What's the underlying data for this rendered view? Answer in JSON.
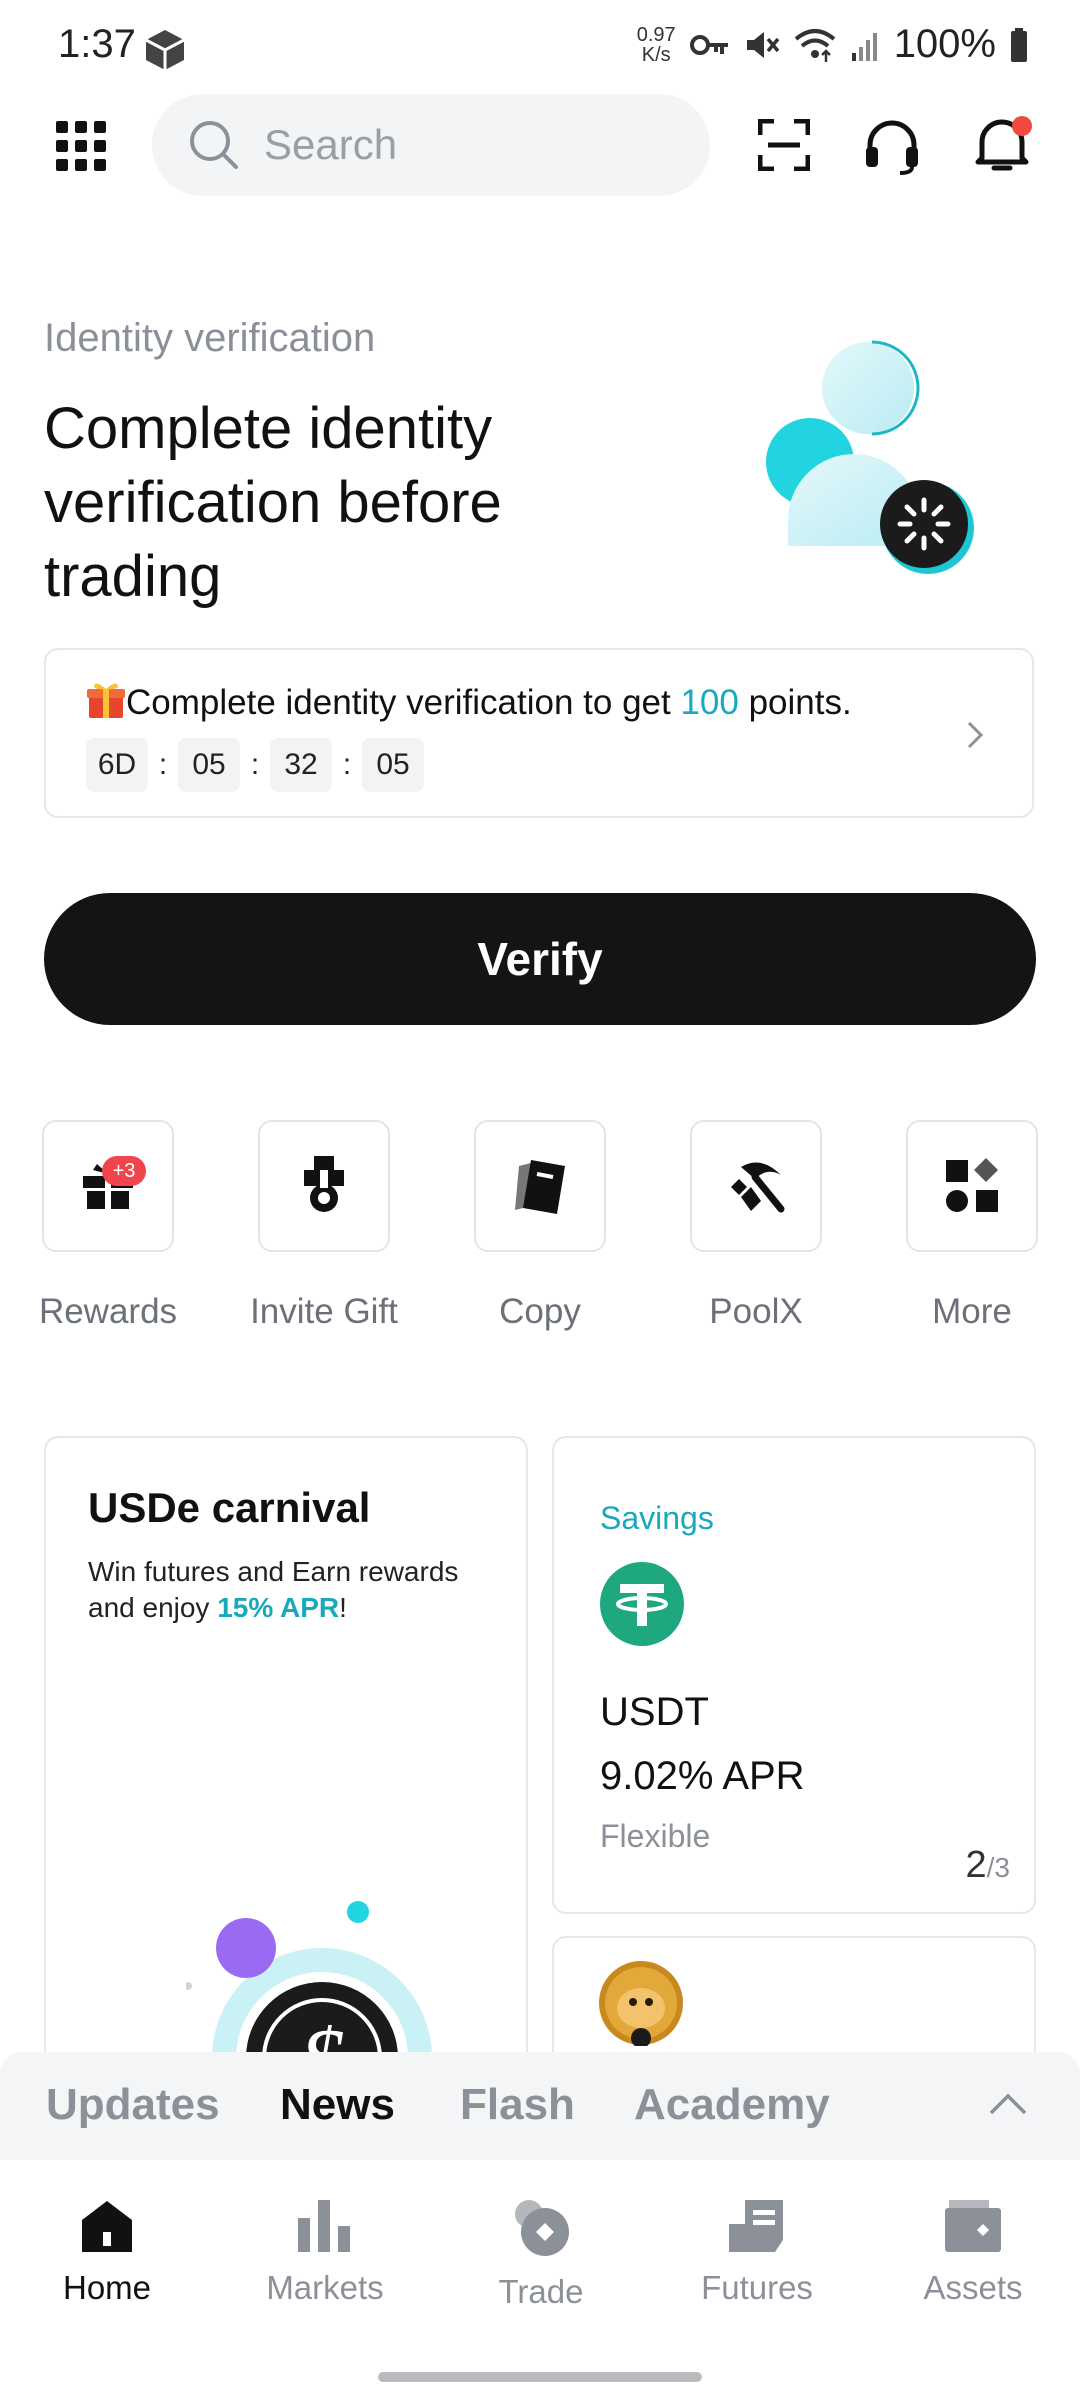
{
  "status_bar": {
    "time": "1:37",
    "net_speed_value": "0.97",
    "net_speed_unit": "K/s",
    "battery": "100%",
    "icons": [
      "package-icon",
      "vpn-key-icon",
      "mute-icon",
      "wifi-icon",
      "signal-icon",
      "battery-icon"
    ]
  },
  "top_bar": {
    "search_placeholder": "Search",
    "icons": [
      "apps-grid-icon",
      "search-icon",
      "scan-icon",
      "support-headset-icon",
      "bell-icon"
    ]
  },
  "kyc": {
    "subtitle": "Identity verification",
    "title": "Complete identity verification before trading",
    "reward_prefix": "Complete identity verification to get ",
    "reward_points": "100",
    "reward_suffix": " points.",
    "timer": {
      "days": "6D",
      "hours": "05",
      "minutes": "32",
      "seconds": "05"
    },
    "verify_label": "Verify",
    "accent_color": "#18a9bf"
  },
  "shortcuts": [
    {
      "label": "Rewards",
      "badge": "+3",
      "icon": "gift-icon"
    },
    {
      "label": "Invite Gift",
      "icon": "medal-icon"
    },
    {
      "label": "Copy",
      "icon": "copy-cards-icon"
    },
    {
      "label": "PoolX",
      "icon": "pickaxe-icon"
    },
    {
      "label": "More",
      "icon": "more-shapes-icon"
    }
  ],
  "promo_card": {
    "title": "USDe carnival",
    "desc_prefix": "Win futures and Earn rewards and enjoy ",
    "desc_highlight": "15% APR",
    "desc_suffix": "!"
  },
  "savings_card": {
    "tag": "Savings",
    "coin": "USDT",
    "apr": "9.02% APR",
    "term": "Flexible",
    "page_current": "2",
    "page_total": "/3"
  },
  "news_tabs": [
    "Updates",
    "News",
    "Flash",
    "Academy"
  ],
  "news_active": "News",
  "bottom_nav": [
    {
      "label": "Home",
      "icon": "home-icon",
      "active": true
    },
    {
      "label": "Markets",
      "icon": "bar-chart-icon",
      "active": false
    },
    {
      "label": "Trade",
      "icon": "trade-icon",
      "active": false
    },
    {
      "label": "Futures",
      "icon": "futures-icon",
      "active": false
    },
    {
      "label": "Assets",
      "icon": "wallet-icon",
      "active": false
    }
  ]
}
